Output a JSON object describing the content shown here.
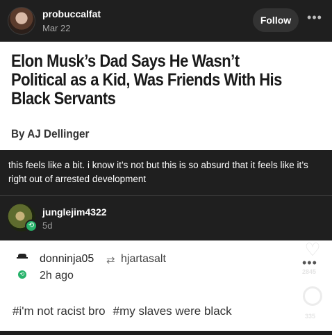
{
  "post": {
    "author": "probuccalfat",
    "date": "Mar 22",
    "follow_label": "Follow",
    "more_label": "•••"
  },
  "article": {
    "headline": "Elon Musk’s Dad Says He Wasn’t Political as a Kid, Was Friends With His Black Servants",
    "byline": "By AJ Dellinger"
  },
  "caption": "this feels like a bit. i know it’s not but this is so absurd that it feels like it’s right out of arrested development",
  "reblogger": {
    "name": "junglejim4322",
    "time": "5d",
    "badge": "⟲"
  },
  "reblog": {
    "username": "donninja05",
    "reblog_icon": "⇄",
    "reblogged_from": "hjartasalt",
    "time_ago": "2h ago",
    "tags": [
      "#i'm not racist bro",
      "#my slaves were black"
    ],
    "more_label": "•••",
    "heart_icon": "♡",
    "notes_count_1": "2845",
    "notes_count_2": "335"
  },
  "colors": {
    "dark_bg": "#1f1f1f",
    "accent_green": "#27b26a"
  }
}
